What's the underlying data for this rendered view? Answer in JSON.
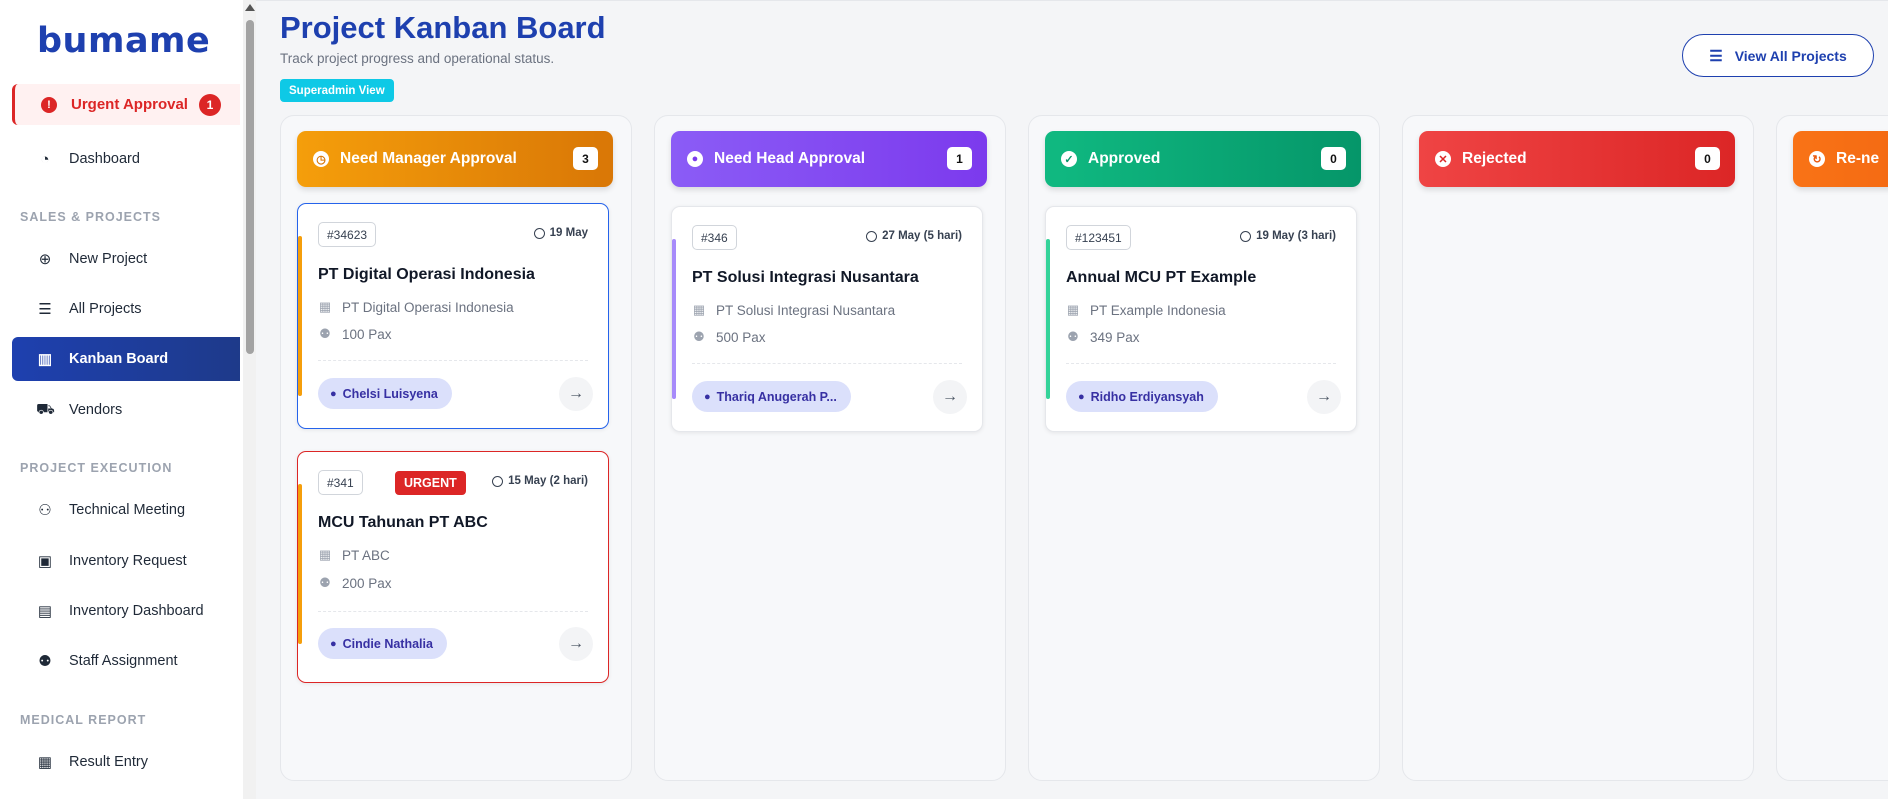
{
  "app": {
    "logo": "bumame"
  },
  "sidebar": {
    "urgent": {
      "label": "Urgent Approval",
      "count": "1"
    },
    "dashboard": "Dashboard",
    "sections": {
      "sales": "SALES & PROJECTS",
      "execution": "PROJECT EXECUTION",
      "medical": "MEDICAL REPORT"
    },
    "items": {
      "new_project": "New Project",
      "all_projects": "All Projects",
      "kanban": "Kanban Board",
      "vendors": "Vendors",
      "technical_meeting": "Technical Meeting",
      "inventory_request": "Inventory Request",
      "inventory_dashboard": "Inventory Dashboard",
      "staff_assignment": "Staff Assignment",
      "result_entry": "Result Entry"
    }
  },
  "header": {
    "title": "Project Kanban Board",
    "subtitle": "Track project progress and operational status.",
    "role_badge": "Superadmin View",
    "view_all": "View All Projects"
  },
  "columns": [
    {
      "title": "Need Manager Approval",
      "count": "3",
      "color": "#f59e0b"
    },
    {
      "title": "Need Head Approval",
      "count": "1",
      "color": "#8b5cf6"
    },
    {
      "title": "Approved",
      "count": "0",
      "color": "#10b981"
    },
    {
      "title": "Rejected",
      "count": "0",
      "color": "#ef4444"
    },
    {
      "title": "Re-ne",
      "color": "#f97316"
    }
  ],
  "cards": {
    "c1": {
      "id": "#34623",
      "date": "19 May",
      "name": "PT Digital Operasi Indonesia",
      "company": "PT Digital Operasi Indonesia",
      "pax": "100 Pax",
      "pic": "Chelsi Luisyena"
    },
    "c2": {
      "id": "#341",
      "urgent": "URGENT",
      "date": "15 May (2 hari)",
      "name": "MCU Tahunan PT ABC",
      "company": "PT ABC",
      "pax": "200 Pax",
      "pic": "Cindie Nathalia"
    },
    "c3": {
      "id": "#346",
      "date": "27 May (5 hari)",
      "name": "PT Solusi Integrasi Nusantara",
      "company": "PT Solusi Integrasi Nusantara",
      "pax": "500 Pax",
      "pic": "Thariq Anugerah P..."
    },
    "c4": {
      "id": "#123451",
      "date": "19 May (3 hari)",
      "name": "Annual MCU PT Example",
      "company": "PT Example Indonesia",
      "pax": "349 Pax",
      "pic": "Ridho Erdiyansyah"
    }
  }
}
